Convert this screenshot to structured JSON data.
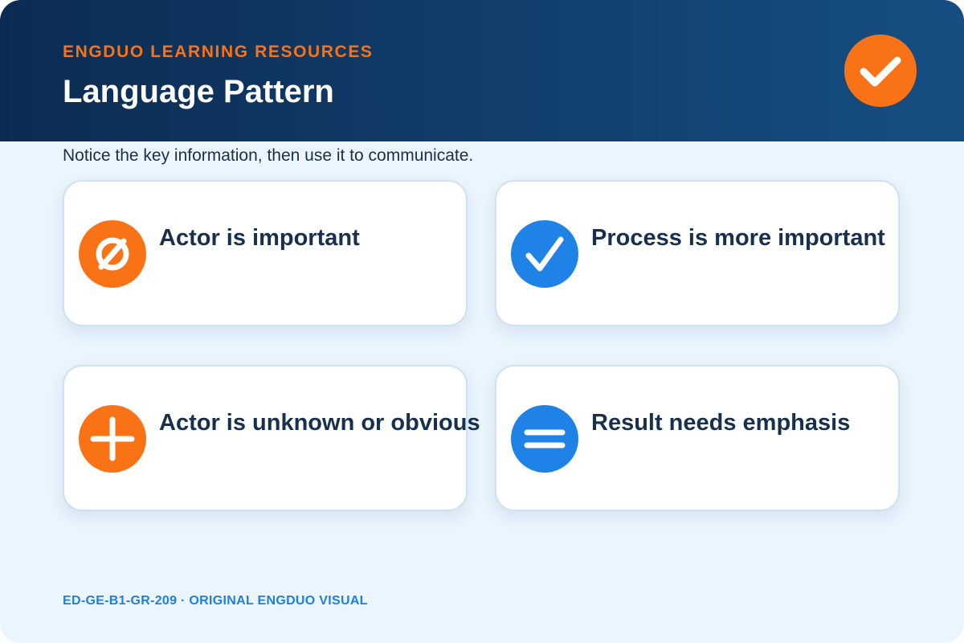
{
  "header": {
    "brand": "ENGDUO LEARNING RESOURCES",
    "title": "Language Pattern",
    "badge_icon": "check-icon"
  },
  "instruction": "Notice the key information, then use it to communicate.",
  "cards": [
    {
      "label": "Actor is important",
      "icon": "empty-set-icon",
      "color": "#f97316"
    },
    {
      "label": "Process is more important",
      "icon": "check-icon",
      "color": "#1f82e6"
    },
    {
      "label": "Actor is unknown or obvious",
      "icon": "plus-icon",
      "color": "#f97316"
    },
    {
      "label": "Result needs emphasis",
      "icon": "equals-icon",
      "color": "#1f82e6"
    }
  ],
  "footer": "ED-GE-B1-GR-209 · ORIGINAL ENGDUO VISUAL",
  "colors": {
    "accent_orange": "#f97316",
    "accent_blue": "#1f82e6",
    "header_dark": "#0b2c52",
    "background": "#eaf5fd"
  }
}
